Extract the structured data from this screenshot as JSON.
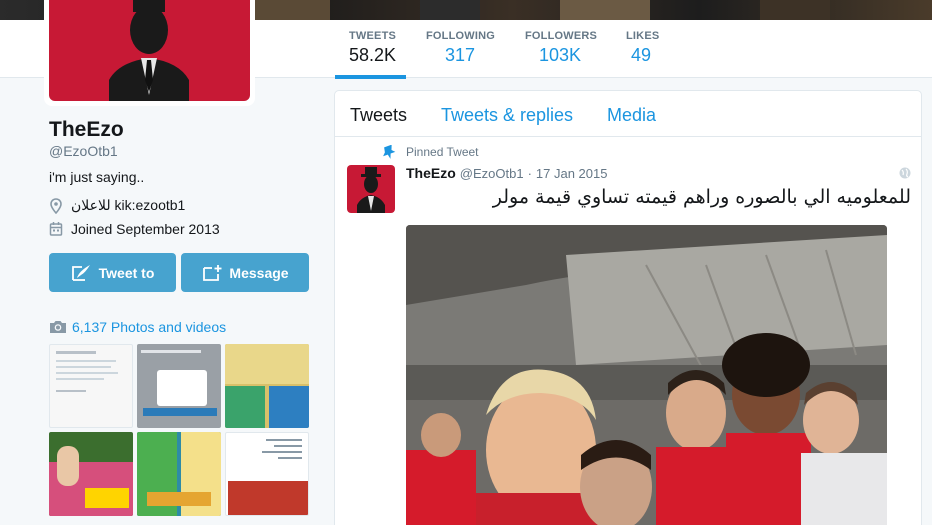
{
  "profile": {
    "name": "TheEzo",
    "handle": "@EzoOtb1",
    "bio": "i'm just saying..",
    "location": "للاعلان kik:ezootb1",
    "joined": "Joined September 2013",
    "tweet_to_label": "Tweet to",
    "message_label": "Message",
    "photos_label": "6,137 Photos and videos"
  },
  "stats": [
    {
      "label": "TWEETS",
      "value": "58.2K"
    },
    {
      "label": "FOLLOWING",
      "value": "317"
    },
    {
      "label": "FOLLOWERS",
      "value": "103K"
    },
    {
      "label": "LIKES",
      "value": "49"
    }
  ],
  "tabs": [
    "Tweets",
    "Tweets & replies",
    "Media"
  ],
  "tweet": {
    "pinned_label": "Pinned Tweet",
    "name": "TheEzo",
    "handle": "@EzoOtb1",
    "separator": "·",
    "date": "17 Jan 2015",
    "text": "للمعلوميه الي بالصوره وراهم قيمته تساوي قيمة مولر"
  },
  "colors": {
    "accent": "#1b95e0",
    "button": "#47a3cf",
    "avatar_red": "#c71935"
  },
  "icons": [
    "location-icon",
    "calendar-icon",
    "compose-icon",
    "message-icon",
    "camera-icon",
    "pin-icon",
    "globe-icon"
  ]
}
